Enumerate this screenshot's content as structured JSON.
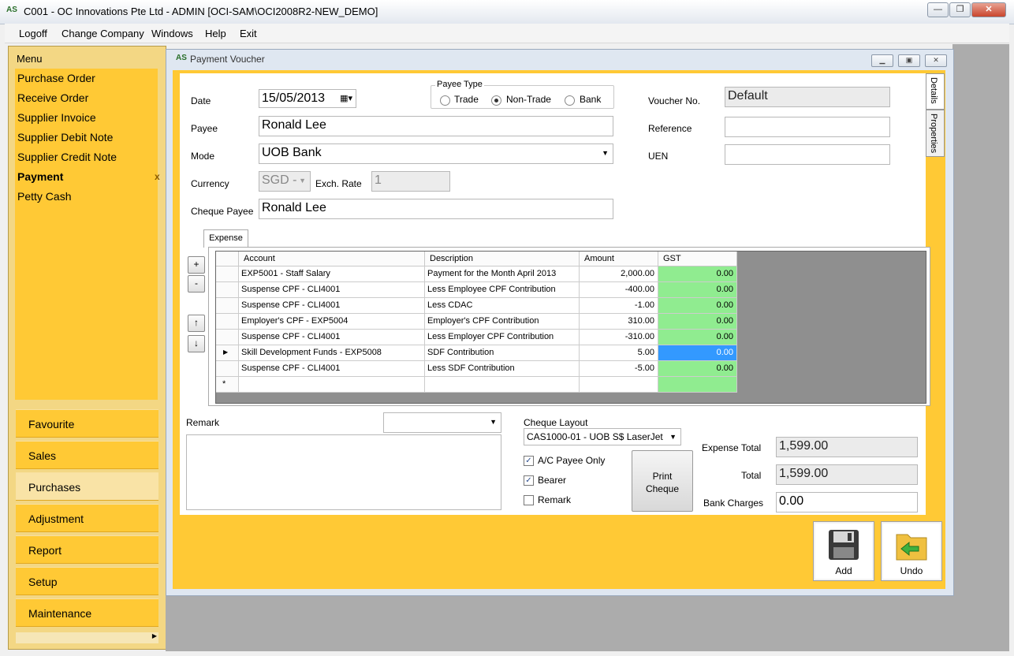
{
  "window": {
    "title": "C001 - OC Innovations Pte Ltd - ADMIN [OCI-SAM\\OCI2008R2-NEW_DEMO]",
    "logo": "AS"
  },
  "menubar": [
    "Logoff",
    "Change Company",
    "Windows",
    "Help",
    "Exit"
  ],
  "sidebar": {
    "header": "Menu",
    "items": [
      "Purchase Order",
      "Receive Order",
      "Supplier Invoice",
      "Supplier Debit Note",
      "Supplier Credit Note",
      "Payment",
      "Petty Cash"
    ],
    "active_item": "Payment",
    "close_mark": "x",
    "nav": [
      "Favourite",
      "Sales",
      "Purchases",
      "Adjustment",
      "Report",
      "Setup",
      "Maintenance"
    ],
    "selected_nav": "Purchases"
  },
  "voucher": {
    "title": "Payment Voucher",
    "side_tabs": [
      "Details",
      "Properties"
    ],
    "date_label": "Date",
    "date_value": "15/05/2013",
    "payee_type_label": "Payee Type",
    "payee_types": [
      "Trade",
      "Non-Trade",
      "Bank"
    ],
    "payee_type_selected": "Non-Trade",
    "payee_label": "Payee",
    "payee_value": "Ronald Lee",
    "mode_label": "Mode",
    "mode_value": "UOB Bank",
    "currency_label": "Currency",
    "currency_value": "SGD -",
    "exch_rate_label": "Exch. Rate",
    "exch_rate_value": "1",
    "cheque_payee_label": "Cheque Payee",
    "cheque_payee_value": "Ronald Lee",
    "voucher_no_label": "Voucher No.",
    "voucher_no_value": "Default",
    "reference_label": "Reference",
    "reference_value": "",
    "uen_label": "UEN",
    "uen_value": ""
  },
  "expense_tab": {
    "label": "Expense",
    "buttons": [
      "+",
      "-",
      "↑",
      "↓"
    ],
    "columns": [
      "Account",
      "Description",
      "Amount",
      "GST"
    ],
    "rows": [
      {
        "account": "EXP5001 - Staff Salary",
        "description": "Payment for the Month April 2013",
        "amount": "2,000.00",
        "gst": "0.00"
      },
      {
        "account": "Suspense CPF - CLI4001",
        "description": "Less Employee CPF Contribution",
        "amount": "-400.00",
        "gst": "0.00"
      },
      {
        "account": "Suspense CPF - CLI4001",
        "description": "Less CDAC",
        "amount": "-1.00",
        "gst": "0.00"
      },
      {
        "account": "Employer's CPF - EXP5004",
        "description": "Employer's CPF Contribution",
        "amount": "310.00",
        "gst": "0.00"
      },
      {
        "account": "Suspense CPF - CLI4001",
        "description": "Less Employer CPF Contribution",
        "amount": "-310.00",
        "gst": "0.00"
      },
      {
        "account": "Skill Development Funds - EXP5008",
        "description": "SDF Contribution",
        "amount": "5.00",
        "gst": "0.00"
      },
      {
        "account": "Suspense CPF - CLI4001",
        "description": "Less SDF Contribution",
        "amount": "-5.00",
        "gst": "0.00"
      }
    ],
    "current_row_marker": "▶",
    "new_row_marker": "*"
  },
  "bottom": {
    "remark_label": "Remark",
    "remark_dropdown": "",
    "cheque_layout_label": "Cheque Layout",
    "cheque_layout_value": "CAS1000-01 - UOB S$ LaserJet",
    "ac_payee_only_label": "A/C Payee Only",
    "bearer_label": "Bearer",
    "remark_check_label": "Remark",
    "ac_payee_only_checked": true,
    "bearer_checked": true,
    "remark_checked": false,
    "print_cheque_label": "Print\nCheque",
    "expense_total_label": "Expense Total",
    "expense_total_value": "1,599.00",
    "total_label": "Total",
    "total_value": "1,599.00",
    "bank_charges_label": "Bank Charges",
    "bank_charges_value": "0.00"
  },
  "actions": {
    "add_label": "Add",
    "undo_label": "Undo"
  },
  "colors": {
    "accent": "#ffc935",
    "gst_cell": "#90ec90",
    "selected_cell": "#3399ff"
  }
}
